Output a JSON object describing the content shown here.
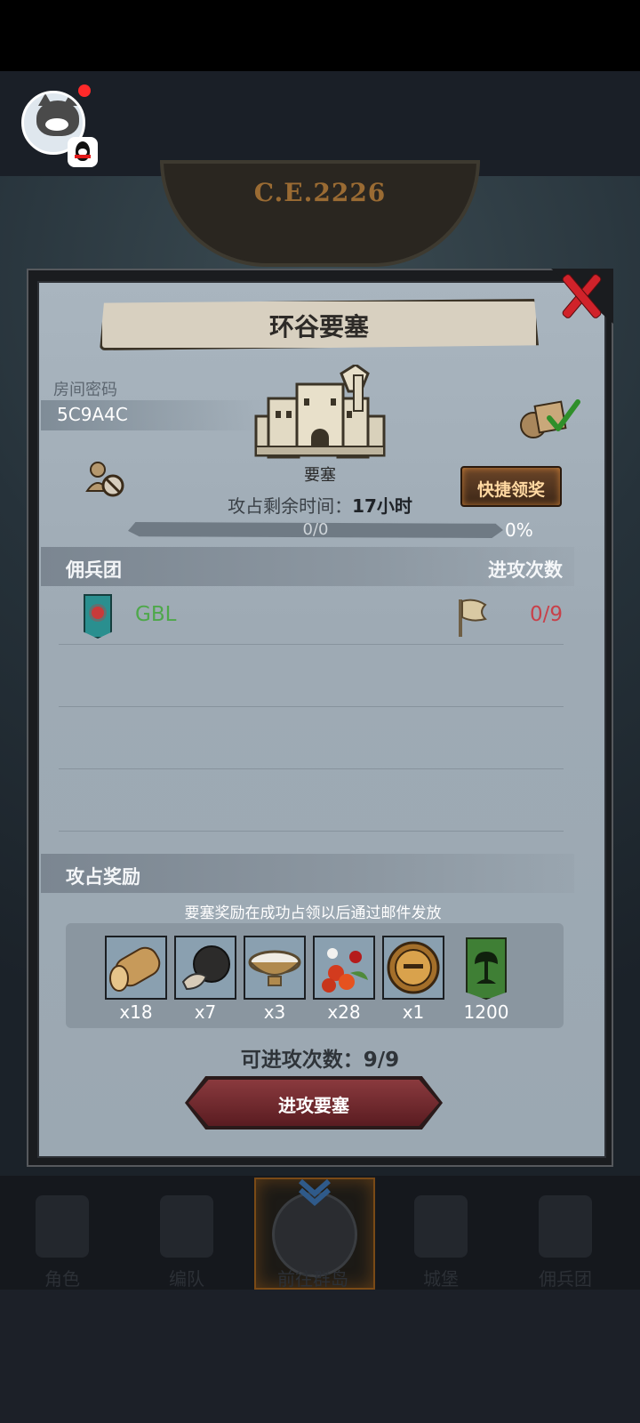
{
  "header": {
    "era_text": "C.E.2226"
  },
  "dialog": {
    "title": "环谷要塞",
    "room_label": "房间密码",
    "room_code": "5C9A4C",
    "fortress_label": "要塞",
    "quick_claim_label": "快捷领奖",
    "time_prefix": "攻占剩余时间：",
    "time_value": "17小时",
    "progress_text": "0/0",
    "progress_percent": "0%",
    "progress_fraction": 0,
    "mercenary_header": "佣兵团",
    "attack_count_header": "进攻次数",
    "guild": {
      "name": "GBL",
      "attacks": "0/9"
    },
    "reward_header": "攻占奖励",
    "reward_note": "要塞奖励在成功占领以后通过邮件发放",
    "rewards": [
      {
        "icon": "log-icon",
        "qty": "x18"
      },
      {
        "icon": "truffle-icon",
        "qty": "x7"
      },
      {
        "icon": "milk-bowl-icon",
        "qty": "x3"
      },
      {
        "icon": "berries-icon",
        "qty": "x28"
      },
      {
        "icon": "helmet-medal-icon",
        "qty": "x1"
      },
      {
        "icon": "tree-banner-icon",
        "qty": "1200"
      }
    ],
    "attacks_left_prefix": "可进攻次数：",
    "attacks_left_value": "9/9",
    "attack_button_label": "进攻要塞"
  },
  "bottom_nav": [
    {
      "label": "角色"
    },
    {
      "label": "编队"
    },
    {
      "label": "前往群岛"
    },
    {
      "label": "城堡"
    },
    {
      "label": "佣兵团"
    }
  ],
  "colors": {
    "guild_name": "#4ea84a",
    "attack_count": "#c8414a",
    "close_x": "#d0222a",
    "quick_button_text": "#ffd8a1"
  }
}
